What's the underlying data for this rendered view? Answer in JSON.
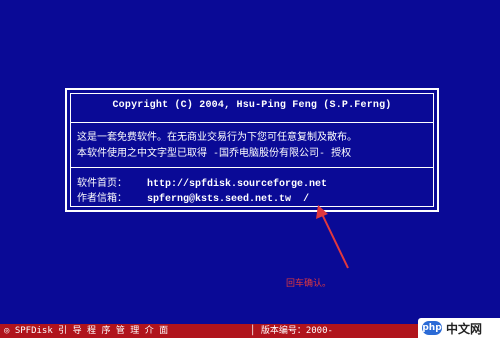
{
  "dialog": {
    "copyright": "Copyright (C) 2004, Hsu-Ping Feng (S.P.Ferng)",
    "description_line1": "这是一套免费软件。在无商业交易行为下您可任意复制及散布。",
    "description_line2": "本软件使用之中文字型已取得 -国乔电脑股份有限公司- 授权",
    "homepage_label": "软件首页：",
    "homepage_value": "http://spfdisk.sourceforge.net",
    "author_email_label": "作者信箱：",
    "author_email_value": "spferng@ksts.seed.net.tw",
    "cursor": "/"
  },
  "annotation": {
    "text": "回车确认。"
  },
  "statusbar": {
    "left": "◎ SPFDisk 引 导 程 序 管 理 介 面",
    "right": "│ 版本编号：2000-"
  },
  "watermark": {
    "logo": "php",
    "text": "中文网"
  },
  "colors": {
    "background": "#0a0a96",
    "statusbar": "#b0141c",
    "annotation": "#e0383e"
  }
}
